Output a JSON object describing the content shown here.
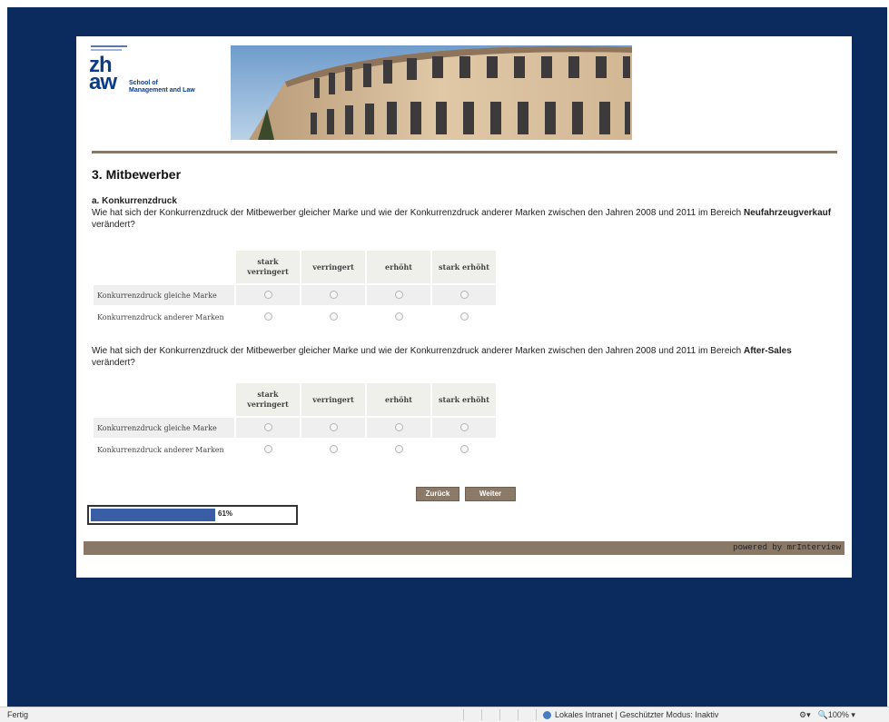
{
  "header": {
    "logo_mark_line1": "zh",
    "logo_mark_line2": "aw",
    "logo_school": "School of",
    "logo_school2": "Management and Law"
  },
  "section_title": "3. Mitbewerber",
  "question_a": {
    "title": "a. Konkurrenzdruck",
    "text_before": "Wie hat sich der Konkurrenzdruck der Mitbewerber gleicher Marke und wie der Konkurrenzdruck anderer Marken zwischen den Jahren 2008 und 2011 im Bereich ",
    "text_bold": "Neufahrzeugverkauf",
    "text_after": " verändert?"
  },
  "question_b": {
    "text_before": "Wie hat sich der Konkurrenzdruck der Mitbewerber gleicher Marke und wie der Konkurrenzdruck anderer Marken zwischen den Jahren 2008 und 2011 im Bereich ",
    "text_bold": "After-Sales",
    "text_after": " verändert?"
  },
  "grid": {
    "columns": [
      "stark verringert",
      "verringert",
      "erhöht",
      "stark erhöht"
    ],
    "rows": [
      "Konkurrenzdruck gleiche Marke",
      "Konkurrenzdruck anderer Marken"
    ]
  },
  "buttons": {
    "back": "Zurück",
    "next": "Weiter"
  },
  "progress": {
    "percent_label": "61%",
    "value": 0.61
  },
  "footer": {
    "powered": "powered by mrInterview"
  },
  "statusbar": {
    "left": "Fertig",
    "zone": "Lokales Intranet | Geschützter Modus: Inaktiv",
    "zoom": "100%"
  },
  "colors": {
    "viewport_bg": "#0b2b5e",
    "accent_brown": "#8a7866",
    "progress_fill": "#3a5ea6"
  }
}
